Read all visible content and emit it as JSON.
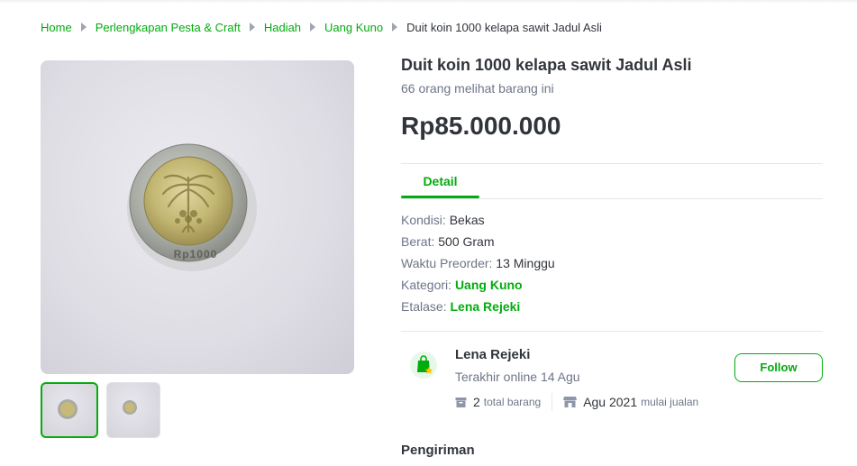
{
  "breadcrumb": {
    "items": [
      "Home",
      "Perlengkapan Pesta & Craft",
      "Hadiah",
      "Uang Kuno"
    ],
    "current": "Duit koin 1000 kelapa sawit Jadul Asli"
  },
  "product": {
    "title": "Duit koin 1000 kelapa sawit Jadul Asli",
    "viewers": "66 orang melihat barang ini",
    "price": "Rp85.000.000",
    "coin_text": "Rp1000",
    "thumbnails_count": 2,
    "active_thumbnail": 1
  },
  "tabs": {
    "detail": "Detail"
  },
  "specs": {
    "kondisi": {
      "key": "Kondisi: ",
      "value": "Bekas"
    },
    "berat": {
      "key": "Berat: ",
      "value": "500 Gram"
    },
    "preorder": {
      "key": "Waktu Preorder: ",
      "value": "13 Minggu"
    },
    "kategori": {
      "key": "Kategori: ",
      "value": "Uang Kuno"
    },
    "etalase": {
      "key": "Etalase: ",
      "value": "Lena Rejeki"
    }
  },
  "shop": {
    "name": "Lena Rejeki",
    "last_online": "Terakhir online 14 Agu",
    "total_count": "2",
    "total_label": "total barang",
    "since": "Agu 2021",
    "since_label": "mulai jualan",
    "follow_label": "Follow"
  },
  "shipping": {
    "title": "Pengiriman"
  },
  "colors": {
    "accent": "#03ac0e",
    "text": "#31353b",
    "muted": "#6d7588",
    "divider": "#e4e7eb"
  },
  "icons": {
    "breadcrumb_separator": "caret-right-icon",
    "shop": "shop-bag-icon",
    "total_items": "box-icon",
    "since": "storefront-icon"
  }
}
